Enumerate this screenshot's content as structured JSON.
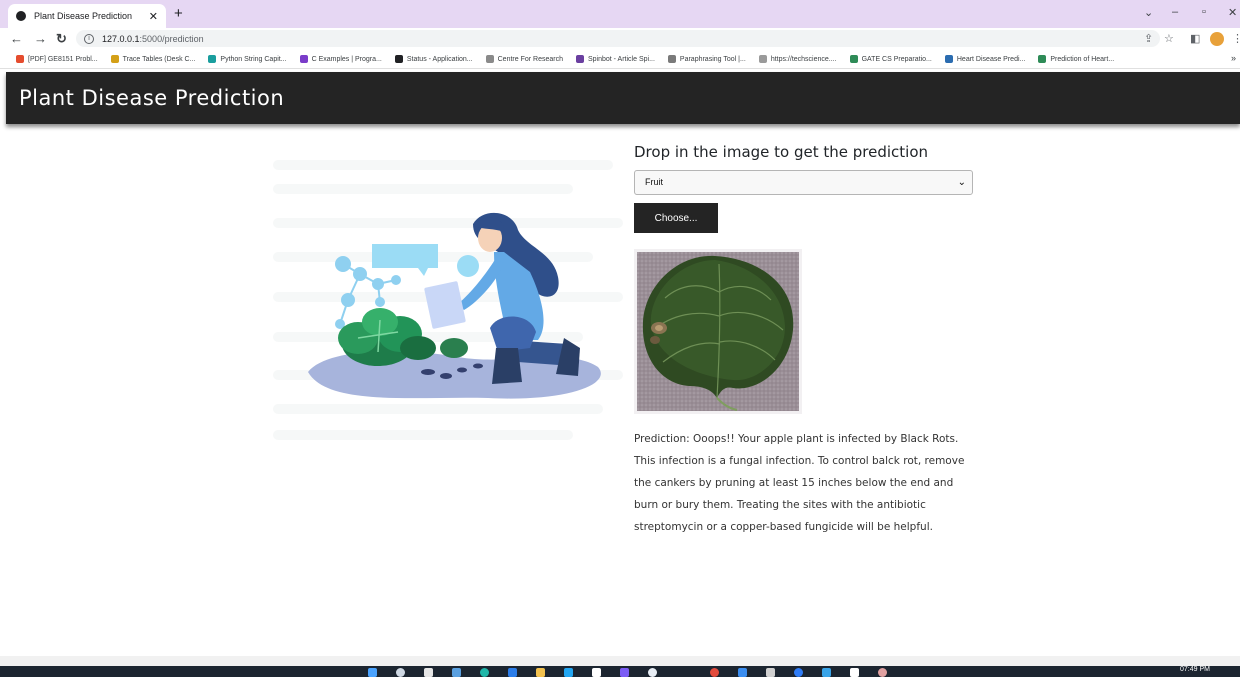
{
  "browser": {
    "tab_title": "Plant Disease Prediction",
    "url_host": "127.0.0.1",
    "url_path": ":5000/prediction",
    "bookmarks": [
      {
        "label": "[PDF] GE8151 Probl...",
        "color": "#e54c2e"
      },
      {
        "label": "Trace Tables (Desk C...",
        "color": "#d4a017"
      },
      {
        "label": "Python String Capit...",
        "color": "#1a9e9e"
      },
      {
        "label": "C Examples | Progra...",
        "color": "#7a3cc9"
      },
      {
        "label": "Status - Application...",
        "color": "#202124"
      },
      {
        "label": "Centre For Research",
        "color": "#8a8a8a"
      },
      {
        "label": "Spinbot - Article Spi...",
        "color": "#6a3fa0"
      },
      {
        "label": "Paraphrasing Tool |...",
        "color": "#7a7a7a"
      },
      {
        "label": "https://techscience....",
        "color": "#9a9a9a"
      },
      {
        "label": "GATE CS Preparatio...",
        "color": "#2e8b57"
      },
      {
        "label": "Heart Disease Predi...",
        "color": "#2b6cb0"
      },
      {
        "label": "Prediction of Heart...",
        "color": "#2e8b57"
      }
    ]
  },
  "page": {
    "brand": "Plant Disease Prediction",
    "heading": "Drop in the image to get the prediction",
    "select_value": "Fruit",
    "choose_label": "Choose...",
    "prediction_text": "Prediction: Ooops!! Your apple plant is infected by Black Rots. This infection is a fungal infection. To control balck rot, remove the cankers by pruning at least 15 inches below the end and burn or bury them. Treating the sites with the antibiotic streptomycin or a copper-based fungicide will be helpful."
  },
  "taskbar": {
    "time": "07:49 PM"
  },
  "colors": {
    "navbar_bg": "#242424",
    "button_bg": "#242424",
    "tabstrip_bg": "#e6d7f3"
  }
}
